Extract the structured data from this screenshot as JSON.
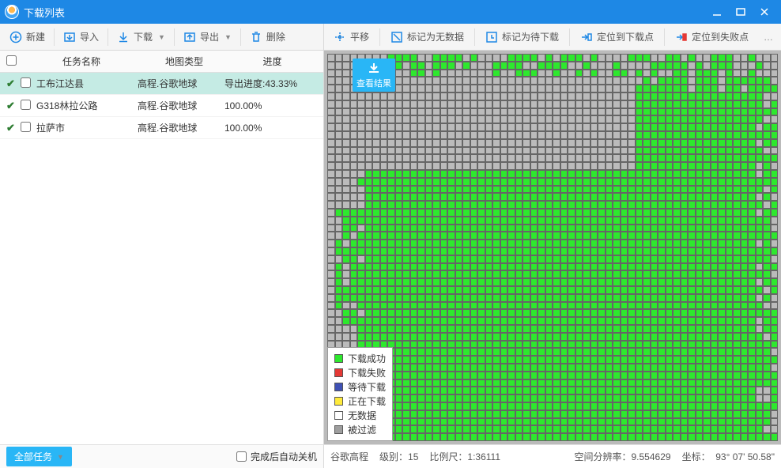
{
  "window": {
    "title": "下载列表"
  },
  "toolbar": {
    "left": [
      {
        "icon": "plus",
        "label": "新建"
      },
      {
        "icon": "import",
        "label": "导入"
      },
      {
        "icon": "download",
        "label": "下载",
        "dropdown": true
      },
      {
        "icon": "export",
        "label": "导出",
        "dropdown": true
      },
      {
        "icon": "trash",
        "label": "删除"
      }
    ],
    "right": [
      {
        "icon": "pan",
        "label": "平移"
      },
      {
        "icon": "mark-nodata",
        "label": "标记为无数据"
      },
      {
        "icon": "mark-pending",
        "label": "标记为待下载"
      },
      {
        "icon": "locate-dl",
        "label": "定位到下载点"
      },
      {
        "icon": "locate-fail",
        "label": "定位到失败点"
      }
    ]
  },
  "table": {
    "headers": {
      "name": "任务名称",
      "type": "地图类型",
      "progress": "进度"
    },
    "rows": [
      {
        "name": "工布江达县",
        "type": "高程.谷歌地球",
        "progress": "导出进度:43.33%",
        "selected": true
      },
      {
        "name": "G318林拉公路",
        "type": "高程.谷歌地球",
        "progress": "100.00%",
        "selected": false
      },
      {
        "name": "拉萨市",
        "type": "高程.谷歌地球",
        "progress": "100.00%",
        "selected": false
      }
    ]
  },
  "view_button": "查看结果",
  "legend": {
    "items": [
      {
        "color": "#2ee82e",
        "label": "下载成功"
      },
      {
        "color": "#e53935",
        "label": "下载失败"
      },
      {
        "color": "#3f51b5",
        "label": "等待下载"
      },
      {
        "color": "#ffeb3b",
        "label": "正在下载"
      },
      {
        "color": "#ffffff",
        "label": "无数据"
      },
      {
        "color": "#9e9e9e",
        "label": "被过滤"
      }
    ]
  },
  "footer": {
    "all_tasks": "全部任务",
    "auto_shutdown": "完成后自动关机",
    "status": {
      "map": "谷歌高程",
      "level_label": "级别：",
      "level": "15",
      "scale_label": "比例尺：",
      "scale": "1:36111",
      "res_label": "空间分辨率：",
      "res": "9.554629",
      "coord_label": "坐标：",
      "coord": "93° 07' 50.58\""
    }
  }
}
